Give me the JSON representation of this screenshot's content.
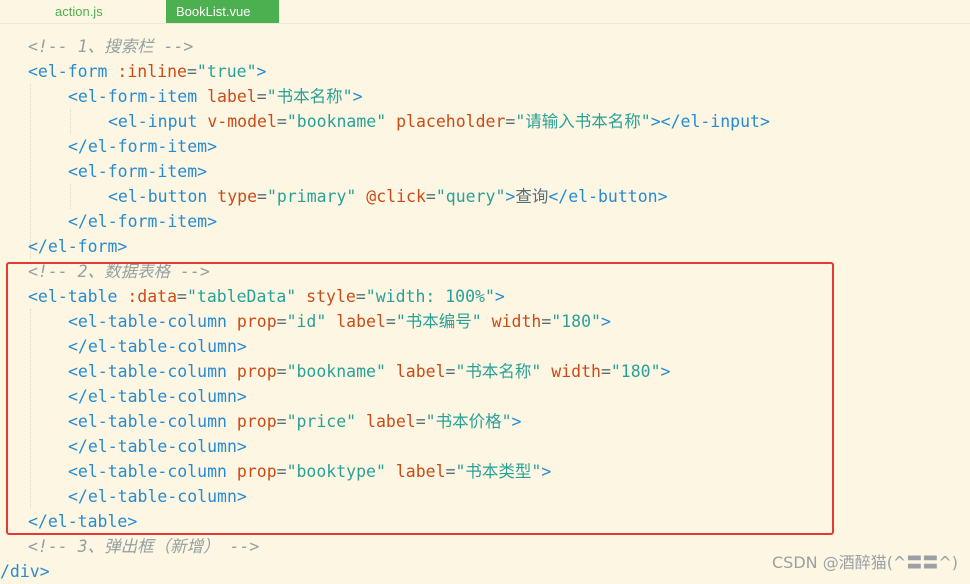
{
  "tabs": [
    {
      "label": "action.js",
      "active": false
    },
    {
      "label": "BookList.vue",
      "active": true
    }
  ],
  "code": {
    "l1": "<!-- 1、搜索栏 -->",
    "l2": {
      "open": "<el-form",
      "attr": " :inline",
      "eq": "=",
      "val": "\"true\"",
      "close": ">"
    },
    "l3": {
      "open": "<el-form-item",
      "attr": " label",
      "eq": "=",
      "val": "\"书本名称\"",
      "close": ">"
    },
    "l4": {
      "open": "<el-input",
      "attr1": " v-model",
      "eq1": "=",
      "val1": "\"bookname\"",
      "attr2": " placeholder",
      "eq2": "=",
      "val2": "\"请输入书本名称\"",
      "close": "></el-input>"
    },
    "l5": "</el-form-item>",
    "l6": "<el-form-item>",
    "l7": {
      "open": "<el-button",
      "attr1": " type",
      "eq1": "=",
      "val1": "\"primary\"",
      "attr2": " @click",
      "eq2": "=",
      "val2": "\"query\"",
      "mid": ">",
      "text": "查询",
      "close": "</el-button>"
    },
    "l8": "</el-form-item>",
    "l9": "</el-form>",
    "l10": "<!-- 2、数据表格 -->",
    "l11": {
      "open": "<el-table",
      "attr1": " :data",
      "eq1": "=",
      "val1": "\"tableData\"",
      "attr2": " style",
      "eq2": "=",
      "val2": "\"width: 100%\"",
      "close": ">"
    },
    "l12": {
      "open": "<el-table-column",
      "attr1": " prop",
      "eq1": "=",
      "val1": "\"id\"",
      "attr2": " label",
      "eq2": "=",
      "val2": "\"书本编号\"",
      "attr3": " width",
      "eq3": "=",
      "val3": "\"180\"",
      "close": ">"
    },
    "l13": "</el-table-column>",
    "l14": {
      "open": "<el-table-column",
      "attr1": " prop",
      "eq1": "=",
      "val1": "\"bookname\"",
      "attr2": " label",
      "eq2": "=",
      "val2": "\"书本名称\"",
      "attr3": " width",
      "eq3": "=",
      "val3": "\"180\"",
      "close": ">"
    },
    "l15": "</el-table-column>",
    "l16": {
      "open": "<el-table-column",
      "attr1": " prop",
      "eq1": "=",
      "val1": "\"price\"",
      "attr2": " label",
      "eq2": "=",
      "val2": "\"书本价格\"",
      "close": ">"
    },
    "l17": "</el-table-column>",
    "l18": {
      "open": "<el-table-column",
      "attr1": " prop",
      "eq1": "=",
      "val1": "\"booktype\"",
      "attr2": " label",
      "eq2": "=",
      "val2": "\"书本类型\"",
      "close": ">"
    },
    "l19": "</el-table-column>",
    "l20": "</el-table>",
    "l21": "<!-- 3、弹出框（新增） -->",
    "l22": "/div>"
  },
  "watermark": "CSDN @酒醉猫(^〓〓^)",
  "colors": {
    "background": "#fdf6e3",
    "tag": "#268bd2",
    "attribute": "#cb4b16",
    "string": "#2aa198",
    "comment": "#93a1a1",
    "active_tab": "#4caf50",
    "highlight_box": "#e53935"
  }
}
